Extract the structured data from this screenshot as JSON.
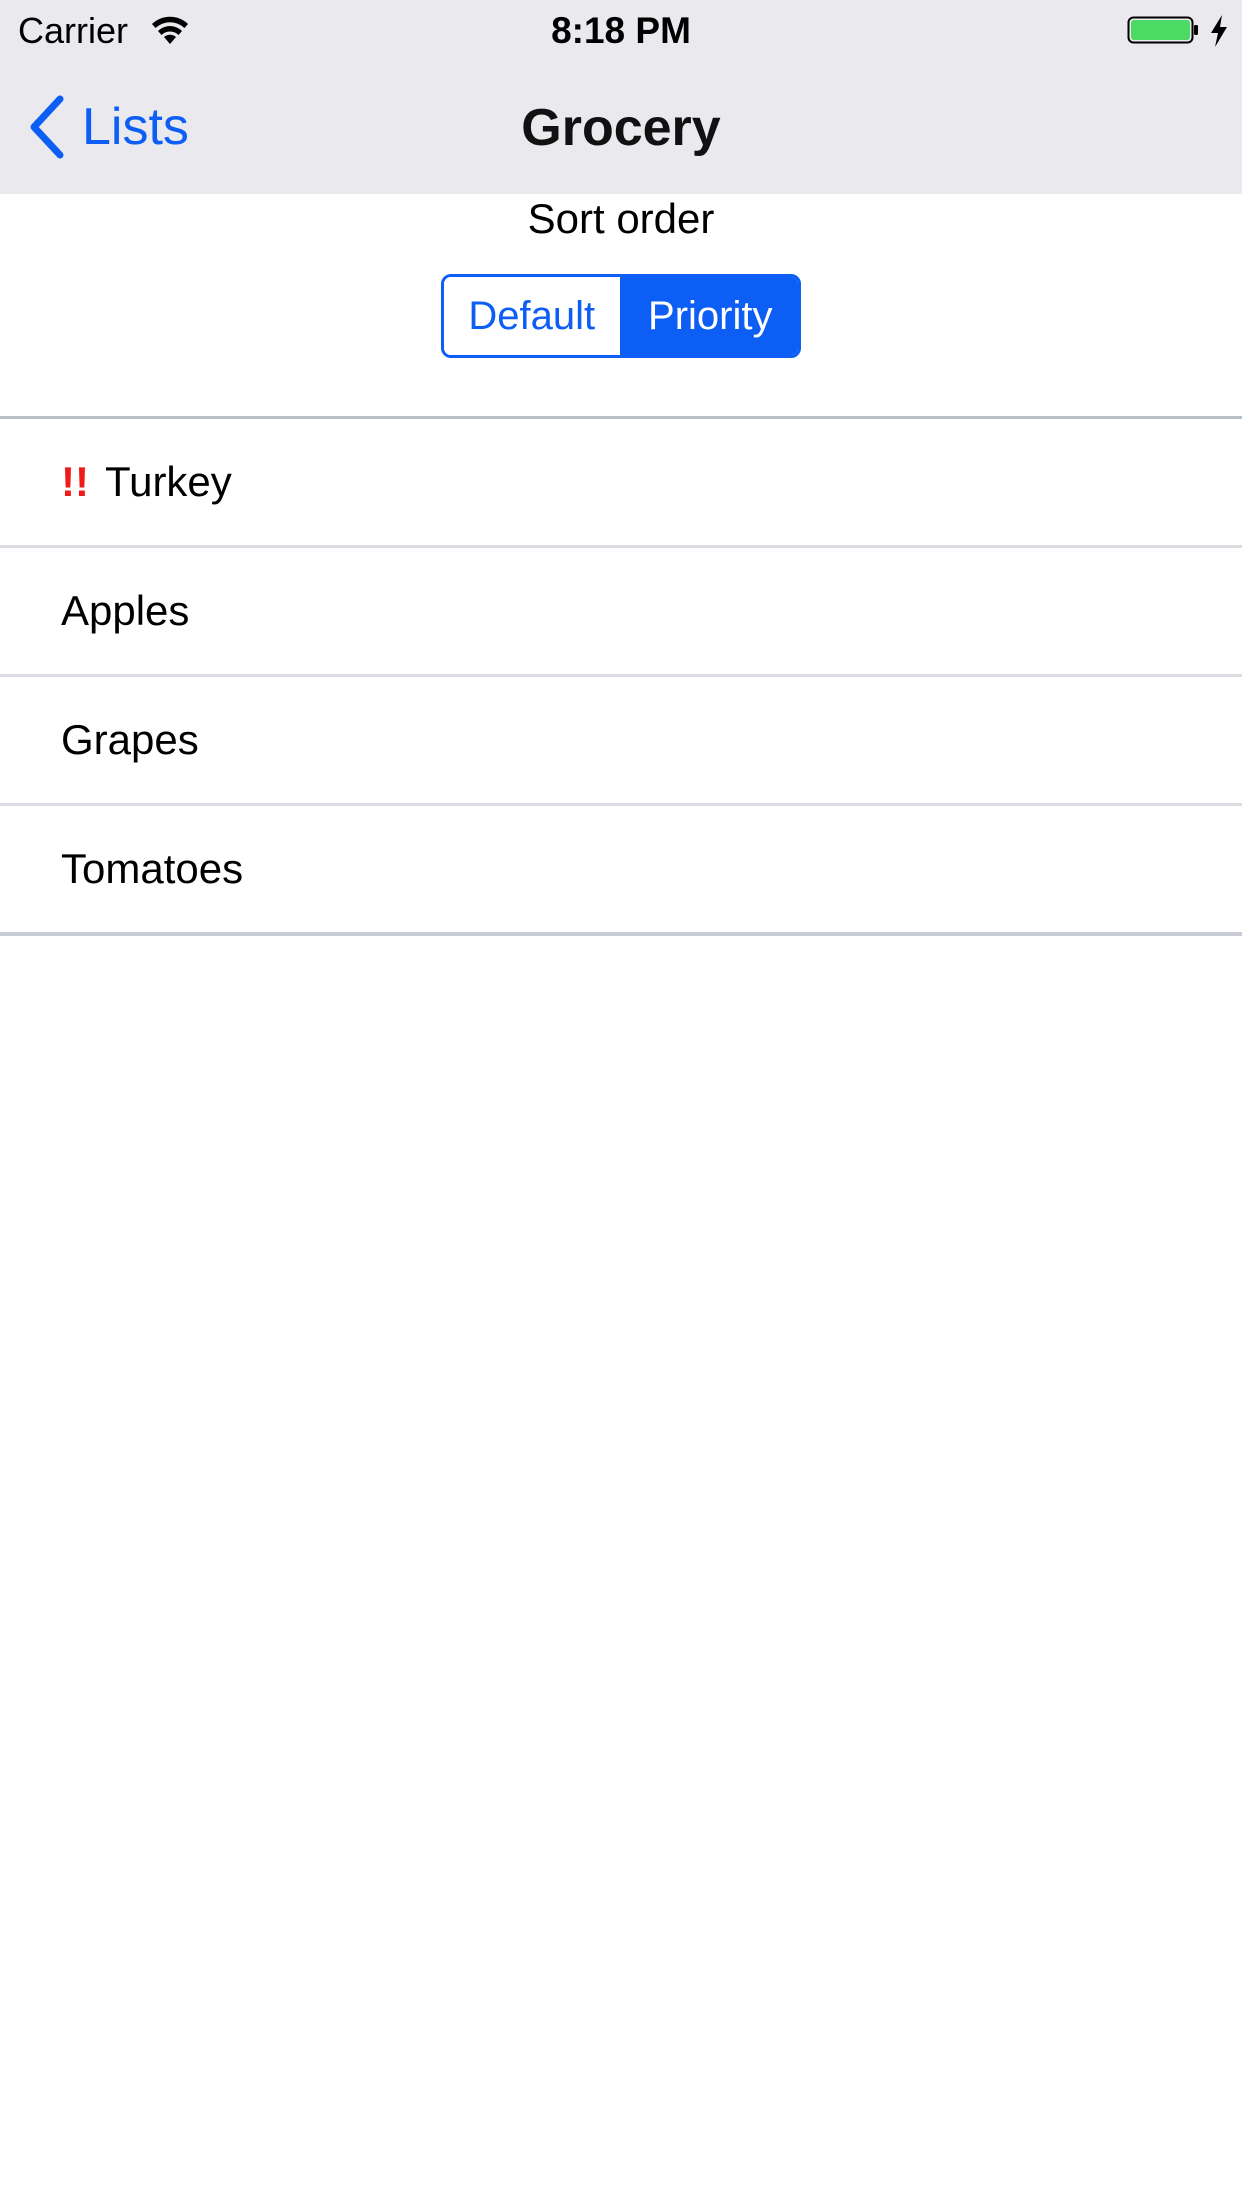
{
  "status_bar": {
    "carrier": "Carrier",
    "time": "8:18 PM",
    "wifi_icon": "wifi-icon",
    "battery_icon": "battery-icon",
    "battery_color": "#4cd964",
    "charging_icon": "bolt-icon"
  },
  "nav": {
    "back_label": "Lists",
    "back_icon": "chevron-left-icon",
    "title": "Grocery"
  },
  "sort": {
    "label": "Sort order",
    "options": [
      "Default",
      "Priority"
    ],
    "selected": "Priority"
  },
  "items": [
    {
      "name": "Turkey",
      "priority_mark": "!!"
    },
    {
      "name": "Apples",
      "priority_mark": ""
    },
    {
      "name": "Grapes",
      "priority_mark": ""
    },
    {
      "name": "Tomatoes",
      "priority_mark": ""
    }
  ],
  "colors": {
    "accent": "#0d5ef4",
    "priority": "#ef1a1a",
    "bar_background": "#e9e9ee"
  }
}
